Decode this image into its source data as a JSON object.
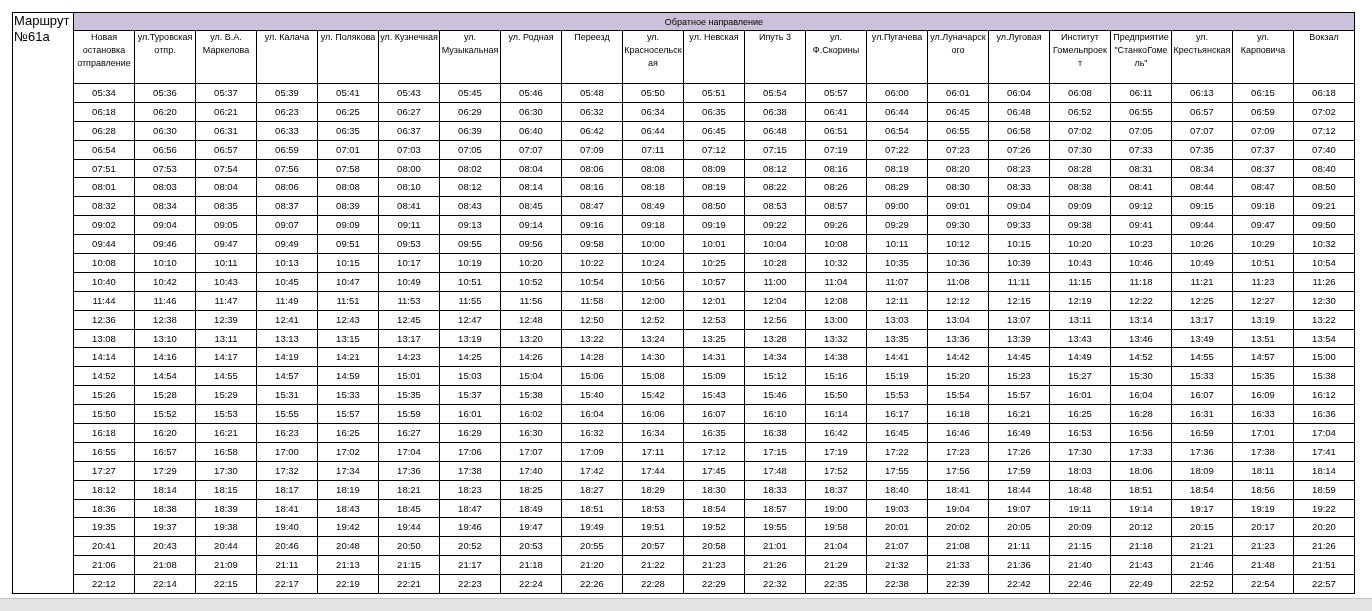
{
  "route_title": "Маршрут №61а",
  "direction_title": "Обратное направление",
  "columns": [
    {
      "header": "Новая остановка отправление",
      "times": [
        "05:34",
        "06:18",
        "06:28",
        "06:54",
        "07:51",
        "08:01",
        "08:32",
        "09:02",
        "09:44",
        "10:08",
        "10:40",
        "11:44",
        "12:36",
        "13:08",
        "14:14",
        "14:52",
        "15:26",
        "15:50",
        "16:18",
        "16:55",
        "17:27",
        "18:12",
        "18:36",
        "19:35",
        "20:41",
        "21:06",
        "22:12"
      ]
    },
    {
      "header": "ул.Туровская отпр.",
      "times": [
        "05:36",
        "06:20",
        "06:30",
        "06:56",
        "07:53",
        "08:03",
        "08:34",
        "09:04",
        "09:46",
        "10:10",
        "10:42",
        "11:46",
        "12:38",
        "13:10",
        "14:16",
        "14:54",
        "15:28",
        "15:52",
        "16:20",
        "16:57",
        "17:29",
        "18:14",
        "18:38",
        "19:37",
        "20:43",
        "21:08",
        "22:14"
      ]
    },
    {
      "header": "ул. В.А. Маркелова",
      "times": [
        "05:37",
        "06:21",
        "06:31",
        "06:57",
        "07:54",
        "08:04",
        "08:35",
        "09:05",
        "09:47",
        "10:11",
        "10:43",
        "11:47",
        "12:39",
        "13:11",
        "14:17",
        "14:55",
        "15:29",
        "15:53",
        "16:21",
        "16:58",
        "17:30",
        "18:15",
        "18:39",
        "19:38",
        "20:44",
        "21:09",
        "22:15"
      ]
    },
    {
      "header": "ул. Калача",
      "times": [
        "05:39",
        "06:23",
        "06:33",
        "06:59",
        "07:56",
        "08:06",
        "08:37",
        "09:07",
        "09:49",
        "10:13",
        "10:45",
        "11:49",
        "12:41",
        "13:13",
        "14:19",
        "14:57",
        "15:31",
        "15:55",
        "16:23",
        "17:00",
        "17:32",
        "18:17",
        "18:41",
        "19:40",
        "20:46",
        "21:11",
        "22:17"
      ]
    },
    {
      "header": "ул. Полякова",
      "times": [
        "05:41",
        "06:25",
        "06:35",
        "07:01",
        "07:58",
        "08:08",
        "08:39",
        "09:09",
        "09:51",
        "10:15",
        "10:47",
        "11:51",
        "12:43",
        "13:15",
        "14:21",
        "14:59",
        "15:33",
        "15:57",
        "16:25",
        "17:02",
        "17:34",
        "18:19",
        "18:43",
        "19:42",
        "20:48",
        "21:13",
        "22:19"
      ]
    },
    {
      "header": "ул. Кузнечная",
      "times": [
        "05:43",
        "06:27",
        "06:37",
        "07:03",
        "08:00",
        "08:10",
        "08:41",
        "09:11",
        "09:53",
        "10:17",
        "10:49",
        "11:53",
        "12:45",
        "13:17",
        "14:23",
        "15:01",
        "15:35",
        "15:59",
        "16:27",
        "17:04",
        "17:36",
        "18:21",
        "18:45",
        "19:44",
        "20:50",
        "21:15",
        "22:21"
      ]
    },
    {
      "header": "ул. Музыкальная",
      "times": [
        "05:45",
        "06:29",
        "06:39",
        "07:05",
        "08:02",
        "08:12",
        "08:43",
        "09:13",
        "09:55",
        "10:19",
        "10:51",
        "11:55",
        "12:47",
        "13:19",
        "14:25",
        "15:03",
        "15:37",
        "16:01",
        "16:29",
        "17:06",
        "17:38",
        "18:23",
        "18:47",
        "19:46",
        "20:52",
        "21:17",
        "22:23"
      ]
    },
    {
      "header": "ул. Родная",
      "times": [
        "05:46",
        "06:30",
        "06:40",
        "07:07",
        "08:04",
        "08:14",
        "08:45",
        "09:14",
        "09:56",
        "10:20",
        "10:52",
        "11:56",
        "12:48",
        "13:20",
        "14:26",
        "15:04",
        "15:38",
        "16:02",
        "16:30",
        "17:07",
        "17:40",
        "18:25",
        "18:49",
        "19:47",
        "20:53",
        "21:18",
        "22:24"
      ]
    },
    {
      "header": "Переезд",
      "times": [
        "05:48",
        "06:32",
        "06:42",
        "07:09",
        "08:06",
        "08:16",
        "08:47",
        "09:16",
        "09:58",
        "10:22",
        "10:54",
        "11:58",
        "12:50",
        "13:22",
        "14:28",
        "15:06",
        "15:40",
        "16:04",
        "16:32",
        "17:09",
        "17:42",
        "18:27",
        "18:51",
        "19:49",
        "20:55",
        "21:20",
        "22:26"
      ]
    },
    {
      "header": "ул. Красносельская",
      "times": [
        "05:50",
        "06:34",
        "06:44",
        "07:11",
        "08:08",
        "08:18",
        "08:49",
        "09:18",
        "10:00",
        "10:24",
        "10:56",
        "12:00",
        "12:52",
        "13:24",
        "14:30",
        "15:08",
        "15:42",
        "16:06",
        "16:34",
        "17:11",
        "17:44",
        "18:29",
        "18:53",
        "19:51",
        "20:57",
        "21:22",
        "22:28"
      ]
    },
    {
      "header": "ул. Невская",
      "times": [
        "05:51",
        "06:35",
        "06:45",
        "07:12",
        "08:09",
        "08:19",
        "08:50",
        "09:19",
        "10:01",
        "10:25",
        "10:57",
        "12:01",
        "12:53",
        "13:25",
        "14:31",
        "15:09",
        "15:43",
        "16:07",
        "16:35",
        "17:12",
        "17:45",
        "18:30",
        "18:54",
        "19:52",
        "20:58",
        "21:23",
        "22:29"
      ]
    },
    {
      "header": "Ипуть 3",
      "times": [
        "05:54",
        "06:38",
        "06:48",
        "07:15",
        "08:12",
        "08:22",
        "08:53",
        "09:22",
        "10:04",
        "10:28",
        "11:00",
        "12:04",
        "12:56",
        "13:28",
        "14:34",
        "15:12",
        "15:46",
        "16:10",
        "16:38",
        "17:15",
        "17:48",
        "18:33",
        "18:57",
        "19:55",
        "21:01",
        "21:26",
        "22:32"
      ]
    },
    {
      "header": "ул. Ф.Скорины",
      "times": [
        "05:57",
        "06:41",
        "06:51",
        "07:19",
        "08:16",
        "08:26",
        "08:57",
        "09:26",
        "10:08",
        "10:32",
        "11:04",
        "12:08",
        "13:00",
        "13:32",
        "14:38",
        "15:16",
        "15:50",
        "16:14",
        "16:42",
        "17:19",
        "17:52",
        "18:37",
        "19:00",
        "19:58",
        "21:04",
        "21:29",
        "22:35"
      ]
    },
    {
      "header": "ул.Пугачева",
      "times": [
        "06:00",
        "06:44",
        "06:54",
        "07:22",
        "08:19",
        "08:29",
        "09:00",
        "09:29",
        "10:11",
        "10:35",
        "11:07",
        "12:11",
        "13:03",
        "13:35",
        "14:41",
        "15:19",
        "15:53",
        "16:17",
        "16:45",
        "17:22",
        "17:55",
        "18:40",
        "19:03",
        "20:01",
        "21:07",
        "21:32",
        "22:38"
      ]
    },
    {
      "header": "ул.Луначарского",
      "times": [
        "06:01",
        "06:45",
        "06:55",
        "07:23",
        "08:20",
        "08:30",
        "09:01",
        "09:30",
        "10:12",
        "10:36",
        "11:08",
        "12:12",
        "13:04",
        "13:36",
        "14:42",
        "15:20",
        "15:54",
        "16:18",
        "16:46",
        "17:23",
        "17:56",
        "18:41",
        "19:04",
        "20:02",
        "21:08",
        "21:33",
        "22:39"
      ]
    },
    {
      "header": "ул.Луговая",
      "times": [
        "06:04",
        "06:48",
        "06:58",
        "07:26",
        "08:23",
        "08:33",
        "09:04",
        "09:33",
        "10:15",
        "10:39",
        "11:11",
        "12:15",
        "13:07",
        "13:39",
        "14:45",
        "15:23",
        "15:57",
        "16:21",
        "16:49",
        "17:26",
        "17:59",
        "18:44",
        "19:07",
        "20:05",
        "21:11",
        "21:36",
        "22:42"
      ]
    },
    {
      "header": "Институт Гомельпроект",
      "times": [
        "06:08",
        "06:52",
        "07:02",
        "07:30",
        "08:28",
        "08:38",
        "09:09",
        "09:38",
        "10:20",
        "10:43",
        "11:15",
        "12:19",
        "13:11",
        "13:43",
        "14:49",
        "15:27",
        "16:01",
        "16:25",
        "16:53",
        "17:30",
        "18:03",
        "18:48",
        "19:11",
        "20:09",
        "21:15",
        "21:40",
        "22:46"
      ]
    },
    {
      "header": "Предприятие \"СтанкоГомель\"",
      "times": [
        "06:11",
        "06:55",
        "07:05",
        "07:33",
        "08:31",
        "08:41",
        "09:12",
        "09:41",
        "10:23",
        "10:46",
        "11:18",
        "12:22",
        "13:14",
        "13:46",
        "14:52",
        "15:30",
        "16:04",
        "16:28",
        "16:56",
        "17:33",
        "18:06",
        "18:51",
        "19:14",
        "20:12",
        "21:18",
        "21:43",
        "22:49"
      ]
    },
    {
      "header": "ул. Крестьянская",
      "times": [
        "06:13",
        "06:57",
        "07:07",
        "07:35",
        "08:34",
        "08:44",
        "09:15",
        "09:44",
        "10:26",
        "10:49",
        "11:21",
        "12:25",
        "13:17",
        "13:49",
        "14:55",
        "15:33",
        "16:07",
        "16:31",
        "16:59",
        "17:36",
        "18:09",
        "18:54",
        "19:17",
        "20:15",
        "21:21",
        "21:46",
        "22:52"
      ]
    },
    {
      "header": "ул. Карповича",
      "times": [
        "06:15",
        "06:59",
        "07:09",
        "07:37",
        "08:37",
        "08:47",
        "09:18",
        "09:47",
        "10:29",
        "10:51",
        "11:23",
        "12:27",
        "13:19",
        "13:51",
        "14:57",
        "15:35",
        "16:09",
        "16:33",
        "17:01",
        "17:38",
        "18:11",
        "18:56",
        "19:19",
        "20:17",
        "21:23",
        "21:48",
        "22:54"
      ]
    },
    {
      "header": "Вокзал",
      "times": [
        "06:18",
        "07:02",
        "07:12",
        "07:40",
        "08:40",
        "08:50",
        "09:21",
        "09:50",
        "10:32",
        "10:54",
        "11:26",
        "12:30",
        "13:22",
        "13:54",
        "15:00",
        "15:38",
        "16:12",
        "16:36",
        "17:04",
        "17:41",
        "18:14",
        "18:59",
        "19:22",
        "20:20",
        "21:26",
        "21:51",
        "22:57"
      ]
    }
  ]
}
